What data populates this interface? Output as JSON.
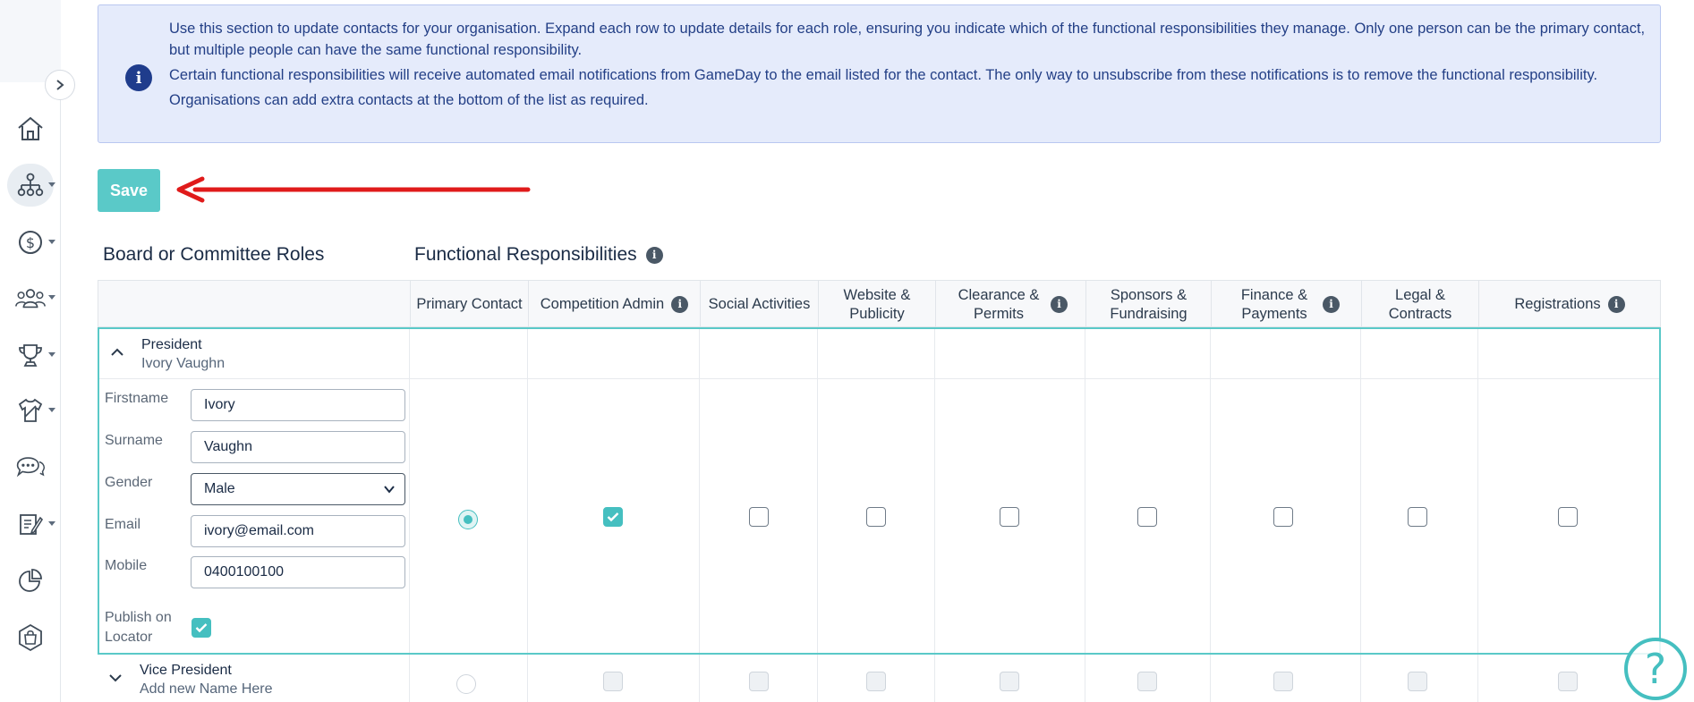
{
  "info": {
    "p1": "Use this section to update contacts for your organisation. Expand each row to update details for each role, ensuring you indicate which of the functional responsibilities they manage. Only one person can be the primary contact, but multiple people can have the same functional responsibility.",
    "p2": "Certain functional responsibilities will receive automated email notifications from GameDay to the email listed for the contact. The only way to unsubscribe from these notifications is to remove the functional responsibility.",
    "p3": "Organisations can add extra contacts at the bottom of the list as required."
  },
  "save_label": "Save",
  "headings": {
    "roles": "Board or Committee Roles",
    "functional": "Functional Responsibilities"
  },
  "columns": [
    {
      "label": "Primary Contact"
    },
    {
      "label": "Competition Admin"
    },
    {
      "label": "Social Activities"
    },
    {
      "label": "Website & Publicity"
    },
    {
      "label": "Clearance & Permits"
    },
    {
      "label": "Sponsors & Fundraising"
    },
    {
      "label": "Finance & Payments"
    },
    {
      "label": "Legal & Contracts"
    },
    {
      "label": "Registrations"
    }
  ],
  "president": {
    "role": "President",
    "name": "Ivory Vaughn",
    "labels": {
      "firstname": "Firstname",
      "surname": "Surname",
      "gender": "Gender",
      "email": "Email",
      "mobile": "Mobile",
      "publish": "Publish on Locator"
    },
    "firstname": "Ivory",
    "surname": "Vaughn",
    "gender": "Male",
    "email": "ivory@email.com",
    "mobile": "0400100100",
    "publish_on_locator": true,
    "primary_contact": true,
    "competition_admin": true
  },
  "vice_president": {
    "role": "Vice President",
    "name": "Add new Name Here"
  },
  "help_label": "?",
  "sidebar": {
    "items": [
      "home-icon",
      "org-chart-icon",
      "finance-icon",
      "members-icon",
      "trophy-icon",
      "uniform-icon",
      "chat-icon",
      "forms-icon",
      "reports-icon",
      "shop-icon"
    ]
  },
  "colors": {
    "accent": "#5ac9c8",
    "info_bg": "#e5ebfb",
    "info_text": "#233f86",
    "arrow": "#e01b1b"
  }
}
